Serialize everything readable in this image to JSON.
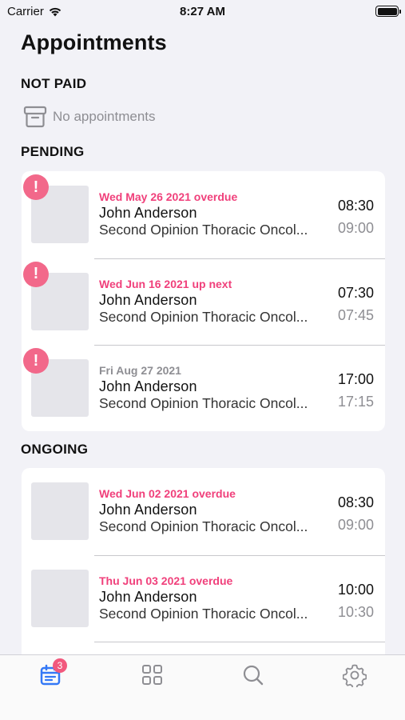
{
  "status_bar": {
    "carrier": "Carrier",
    "time": "8:27 AM"
  },
  "page": {
    "title": "Appointments"
  },
  "sections": {
    "not_paid": {
      "header": "NOT PAID",
      "empty_text": "No appointments"
    },
    "pending": {
      "header": "PENDING"
    },
    "ongoing": {
      "header": "ONGOING"
    }
  },
  "pending_items": [
    {
      "date": "Wed May 26 2021 overdue",
      "name": "John Anderson",
      "subtitle": "Second Opinion Thoracic Oncol...",
      "start": "08:30",
      "end": "09:00",
      "alert": "!"
    },
    {
      "date": "Wed Jun 16 2021 up next",
      "name": "John Anderson",
      "subtitle": "Second Opinion Thoracic Oncol...",
      "start": "07:30",
      "end": "07:45",
      "alert": "!"
    },
    {
      "date": "Fri Aug 27 2021",
      "name": "John Anderson",
      "subtitle": "Second Opinion Thoracic Oncol...",
      "start": "17:00",
      "end": "17:15",
      "alert": "!"
    }
  ],
  "ongoing_items": [
    {
      "date": "Wed Jun 02 2021 overdue",
      "name": "John Anderson",
      "subtitle": "Second Opinion Thoracic Oncol...",
      "start": "08:30",
      "end": "09:00"
    },
    {
      "date": "Thu Jun 03 2021 overdue",
      "name": "John Anderson",
      "subtitle": "Second Opinion Thoracic Oncol...",
      "start": "10:00",
      "end": "10:30"
    }
  ],
  "tab_bar": {
    "badge": "3",
    "tabs": [
      {
        "icon": "calendar-icon",
        "active": true
      },
      {
        "icon": "grid-icon",
        "active": false
      },
      {
        "icon": "search-icon",
        "active": false
      },
      {
        "icon": "gear-icon",
        "active": false
      }
    ]
  },
  "colors": {
    "accent": "#3478f6",
    "overdue": "#f0407b",
    "alert": "#f2688a",
    "badge": "#f2587d"
  }
}
